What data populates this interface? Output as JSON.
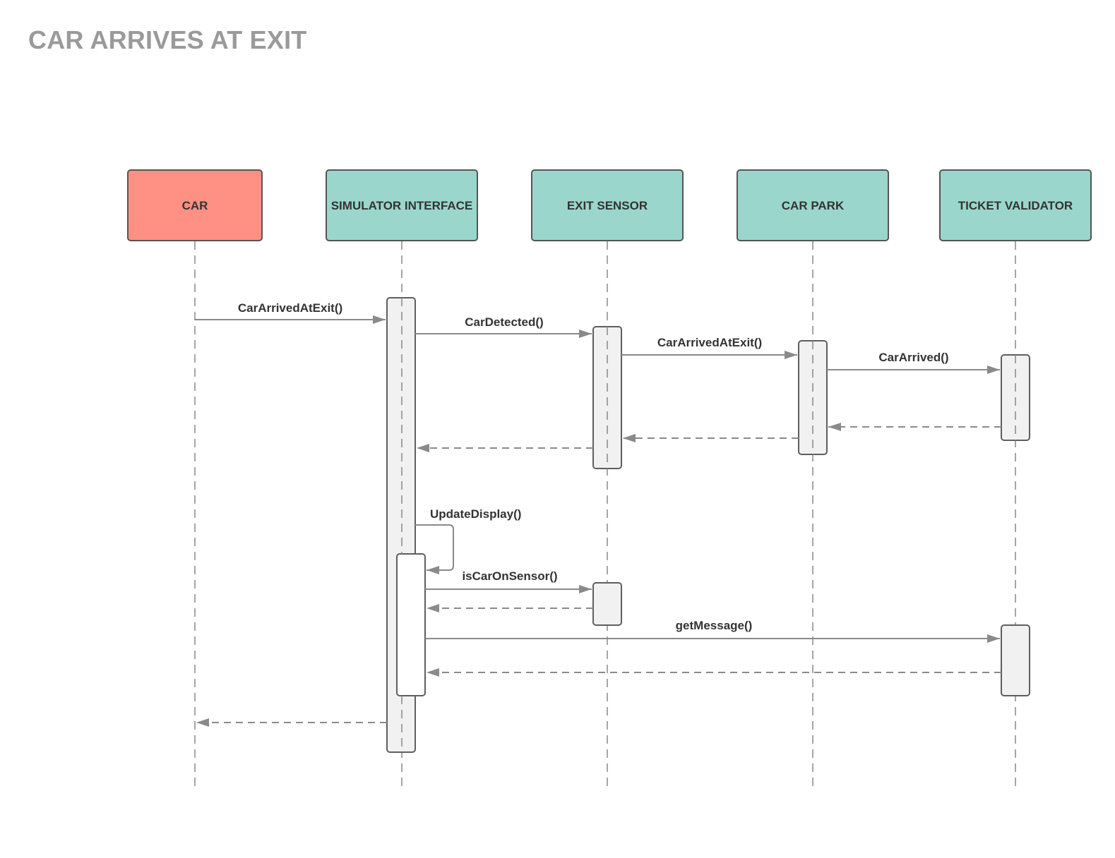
{
  "title": "CAR ARRIVES AT EXIT",
  "colors": {
    "actor_car": "#ff9083",
    "actor_default": "#9ad6cb",
    "line": "#8a8a8a",
    "title": "#9a9a9a"
  },
  "participants": [
    {
      "id": "car",
      "label": "CAR",
      "color": "#ff9083"
    },
    {
      "id": "sim",
      "label": "SIMULATOR INTERFACE",
      "color": "#9ad6cb"
    },
    {
      "id": "sensor",
      "label": "EXIT SENSOR",
      "color": "#9ad6cb"
    },
    {
      "id": "park",
      "label": "CAR PARK",
      "color": "#9ad6cb"
    },
    {
      "id": "validator",
      "label": "TICKET VALIDATOR",
      "color": "#9ad6cb"
    }
  ],
  "messages": [
    {
      "from": "car",
      "to": "sim",
      "label": "CarArrivedAtExit()",
      "kind": "call"
    },
    {
      "from": "sim",
      "to": "sensor",
      "label": "CarDetected()",
      "kind": "call"
    },
    {
      "from": "sensor",
      "to": "park",
      "label": "CarArrivedAtExit()",
      "kind": "call"
    },
    {
      "from": "park",
      "to": "validator",
      "label": "CarArrived()",
      "kind": "call"
    },
    {
      "from": "validator",
      "to": "park",
      "label": "",
      "kind": "return"
    },
    {
      "from": "park",
      "to": "sensor",
      "label": "",
      "kind": "return"
    },
    {
      "from": "sensor",
      "to": "sim",
      "label": "",
      "kind": "return"
    },
    {
      "from": "sim",
      "to": "sim",
      "label": "UpdateDisplay()",
      "kind": "self"
    },
    {
      "from": "sim",
      "to": "sensor",
      "label": "isCarOnSensor()",
      "kind": "call"
    },
    {
      "from": "sensor",
      "to": "sim",
      "label": "",
      "kind": "return"
    },
    {
      "from": "sim",
      "to": "validator",
      "label": "getMessage()",
      "kind": "call"
    },
    {
      "from": "validator",
      "to": "sim",
      "label": "",
      "kind": "return"
    },
    {
      "from": "sim",
      "to": "car",
      "label": "",
      "kind": "return"
    }
  ]
}
